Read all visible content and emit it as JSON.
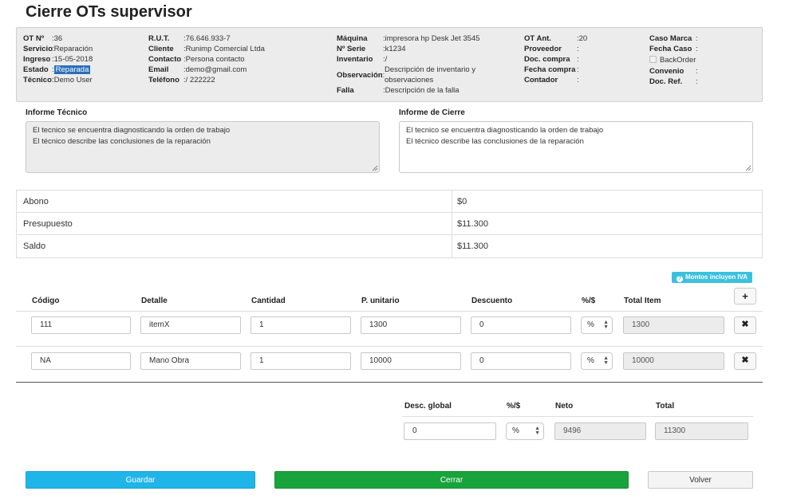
{
  "title": "Cierre OTs supervisor",
  "info": {
    "ot_label": "OT Nº",
    "ot": ":36",
    "servicio_label": "Servicio",
    "servicio": ":Reparación",
    "ingreso_label": "Ingreso",
    "ingreso": ":15-05-2018",
    "estado_label": "Estado",
    "estado_prefix": ":",
    "estado": "Reparada",
    "tecnico_label": "Técnico",
    "tecnico": ":Demo User",
    "rut_label": "R.U.T.",
    "rut": ":76.646.933-7",
    "cliente_label": "Cliente",
    "cliente": ":Runimp Comercial Ltda",
    "contacto_label": "Contacto",
    "contacto": ":Persona contacto",
    "email_label": "Email",
    "email": ":demo@gmail.com",
    "telefono_label": "Teléfono",
    "telefono": ":/ 222222",
    "maquina_label": "Máquina",
    "maquina": ":impresora hp Desk Jet 3545",
    "serie_label": "Nº Serie",
    "serie": ":k1234",
    "inventario_label": "Inventario",
    "inventario": ":/",
    "observacion_label": "Observación",
    "observacion_line1": "Descripción de inventario y",
    "observacion_line2": "observaciones",
    "falla_label": "Falla",
    "falla": ":Descripción de la falla",
    "ot_ant_label": "OT Ant.",
    "ot_ant": ":20",
    "proveedor_label": "Proveedor",
    "proveedor": ":",
    "doc_compra_label": "Doc. compra",
    "doc_compra": ":",
    "fecha_compra_label": "Fecha compra",
    "fecha_compra": ":",
    "contador_label": "Contador",
    "contador": ":",
    "caso_marca_label": "Caso Marca",
    "caso_marca": ":",
    "fecha_caso_label": "Fecha Caso",
    "fecha_caso": ":",
    "backorder_label": "BackOrder",
    "convenio_label": "Convenio",
    "convenio": ":",
    "doc_ref_label": "Doc. Ref.",
    "doc_ref": ":"
  },
  "informe_tecnico": {
    "label": "Informe Técnico",
    "text": "El tecnico se encuentra diagnosticando la orden de trabajo\nEl técnico describe las conclusiones de la reparación"
  },
  "informe_cierre": {
    "label": "Informe de Cierre",
    "text": "El tecnico se encuentra diagnosticando la orden de trabajo\nEl técnico describe las conclusiones de la reparación"
  },
  "summary": [
    {
      "label": "Abono",
      "value": "$0"
    },
    {
      "label": "Presupuesto",
      "value": "$11.300"
    },
    {
      "label": "Saldo",
      "value": "$11.300"
    }
  ],
  "iva_badge": "Montos incluyen IVA",
  "items_header": {
    "codigo": "Código",
    "detalle": "Detalle",
    "cantidad": "Cantidad",
    "p_unitario": "P. unitario",
    "descuento": "Descuento",
    "tipo": "%/$",
    "total_item": "Total Item"
  },
  "add_button": "+",
  "items": [
    {
      "codigo": "111",
      "detalle": "itemX",
      "cantidad": "1",
      "p_unitario": "1300",
      "descuento": "0",
      "tipo": "%",
      "total": "1300",
      "remove": "✖"
    },
    {
      "codigo": "NA",
      "detalle": "Mano Obra",
      "cantidad": "1",
      "p_unitario": "10000",
      "descuento": "0",
      "tipo": "%",
      "total": "10000",
      "remove": "✖"
    }
  ],
  "totals": {
    "desc_global_label": "Desc. global",
    "desc_global": "0",
    "tipo_label": "%/$",
    "tipo": "%",
    "neto_label": "Neto",
    "neto": "9496",
    "total_label": "Total",
    "total": "11300"
  },
  "buttons": {
    "guardar": "Guardar",
    "cerrar": "Cerrar",
    "volver": "Volver"
  }
}
